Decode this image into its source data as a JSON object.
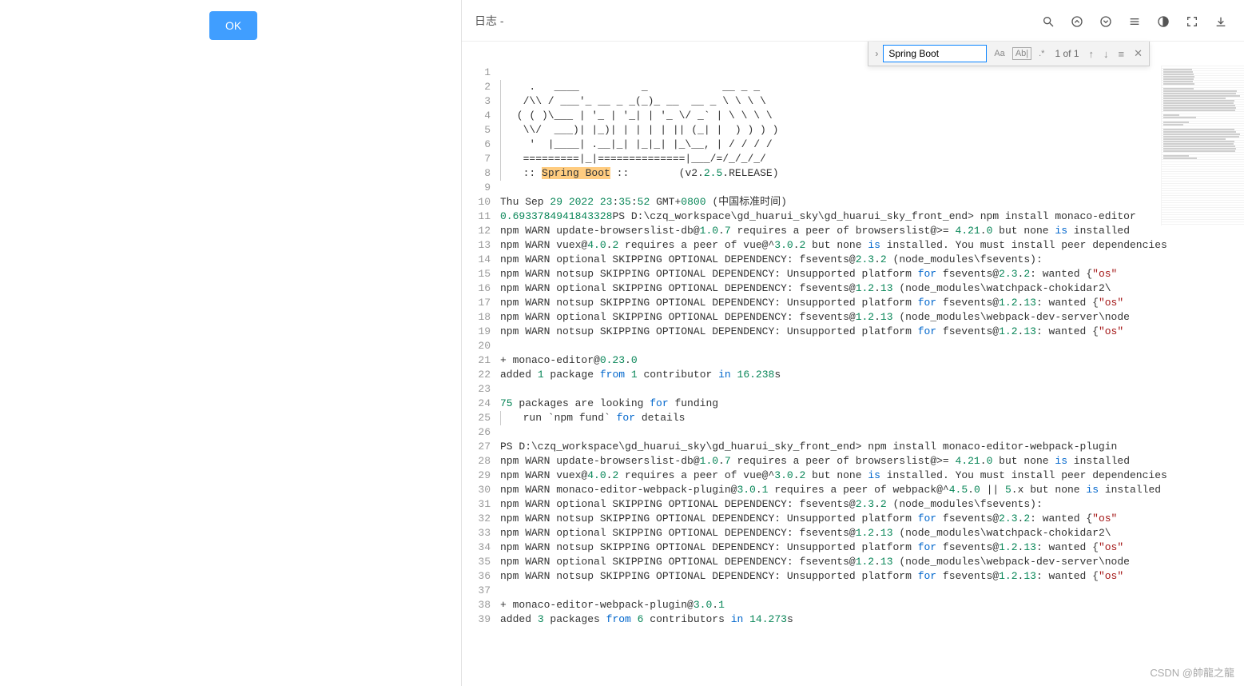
{
  "left": {
    "ok_label": "OK"
  },
  "header": {
    "title": "日志 -"
  },
  "toolbar": {
    "icons": [
      "search",
      "collapse-up",
      "expand-down",
      "menu",
      "contrast",
      "fullscreen",
      "download"
    ]
  },
  "find": {
    "input": "Spring Boot",
    "opt_case": "Aa",
    "opt_word": "Ab|",
    "opt_regex": ".*",
    "count": "1 of 1"
  },
  "editor": {
    "total_lines": 39,
    "lines": [
      {
        "n": 1,
        "segs": []
      },
      {
        "n": 2,
        "indent": true,
        "segs": [
          {
            "t": "   .   ____          _            __ _ _"
          }
        ]
      },
      {
        "n": 3,
        "indent": true,
        "segs": [
          {
            "t": "  /\\\\ / ___'_ __ _ _(_)_ __  __ _ \\ \\ \\ \\"
          }
        ]
      },
      {
        "n": 4,
        "indent": true,
        "segs": [
          {
            "t": " ( ( )\\___ | '_ | '_| | '_ \\/ _` | \\ \\ \\ \\"
          }
        ]
      },
      {
        "n": 5,
        "indent": true,
        "segs": [
          {
            "t": "  \\\\/  ___)| |_)| | | | | || (_| |  ) ) ) )"
          }
        ]
      },
      {
        "n": 6,
        "indent": true,
        "segs": [
          {
            "t": "   '  |____| .__|_| |_|_| |_\\__, | / / / /"
          }
        ]
      },
      {
        "n": 7,
        "indent": true,
        "segs": [
          {
            "t": "  =========|_|==============|___/=/_/_/_/"
          }
        ]
      },
      {
        "n": 8,
        "indent": true,
        "segs": [
          {
            "t": "  :: ",
            "c": ""
          },
          {
            "t": "Spring Boot",
            "c": "hl"
          },
          {
            "t": " ::        (v2.",
            "c": ""
          },
          {
            "t": "2.5",
            "c": "c-num"
          },
          {
            "t": ".RELEASE)",
            "c": ""
          }
        ]
      },
      {
        "n": 9,
        "segs": []
      },
      {
        "n": 10,
        "segs": [
          {
            "t": "Thu Sep ",
            "c": ""
          },
          {
            "t": "29 2022 23",
            "c": "c-num"
          },
          {
            "t": ":",
            "c": ""
          },
          {
            "t": "35",
            "c": "c-num"
          },
          {
            "t": ":",
            "c": ""
          },
          {
            "t": "52",
            "c": "c-num"
          },
          {
            "t": " GMT+",
            "c": ""
          },
          {
            "t": "0800",
            "c": "c-num"
          },
          {
            "t": " (中国标准时间)",
            "c": ""
          }
        ]
      },
      {
        "n": 11,
        "segs": [
          {
            "t": "0.6933784941843328",
            "c": "c-num"
          },
          {
            "t": "PS D:\\czq_workspace\\gd_huarui_sky\\gd_huarui_sky_front_end> npm install monaco-editor",
            "c": ""
          }
        ]
      },
      {
        "n": 12,
        "segs": [
          {
            "t": "npm WARN update-browserslist-db@",
            "c": ""
          },
          {
            "t": "1.0",
            "c": "c-num"
          },
          {
            "t": ".",
            "c": ""
          },
          {
            "t": "7",
            "c": "c-num"
          },
          {
            "t": " requires a peer of browserslist@>= ",
            "c": ""
          },
          {
            "t": "4.21",
            "c": "c-num"
          },
          {
            "t": ".",
            "c": ""
          },
          {
            "t": "0",
            "c": "c-num"
          },
          {
            "t": " but none ",
            "c": ""
          },
          {
            "t": "is",
            "c": "c-blue"
          },
          {
            "t": " installed",
            "c": ""
          }
        ]
      },
      {
        "n": 13,
        "segs": [
          {
            "t": "npm WARN vuex@",
            "c": ""
          },
          {
            "t": "4.0",
            "c": "c-num"
          },
          {
            "t": ".",
            "c": ""
          },
          {
            "t": "2",
            "c": "c-num"
          },
          {
            "t": " requires a peer of vue@^",
            "c": ""
          },
          {
            "t": "3.0",
            "c": "c-num"
          },
          {
            "t": ".",
            "c": ""
          },
          {
            "t": "2",
            "c": "c-num"
          },
          {
            "t": " but none ",
            "c": ""
          },
          {
            "t": "is",
            "c": "c-blue"
          },
          {
            "t": " installed. You must install peer dependencies",
            "c": ""
          }
        ]
      },
      {
        "n": 14,
        "segs": [
          {
            "t": "npm WARN optional SKIPPING OPTIONAL DEPENDENCY: fsevents@",
            "c": ""
          },
          {
            "t": "2.3",
            "c": "c-num"
          },
          {
            "t": ".",
            "c": ""
          },
          {
            "t": "2",
            "c": "c-num"
          },
          {
            "t": " (node_modules\\fsevents):",
            "c": ""
          }
        ]
      },
      {
        "n": 15,
        "segs": [
          {
            "t": "npm WARN notsup SKIPPING OPTIONAL DEPENDENCY: Unsupported platform ",
            "c": ""
          },
          {
            "t": "for",
            "c": "c-blue"
          },
          {
            "t": " fsevents@",
            "c": ""
          },
          {
            "t": "2.3",
            "c": "c-num"
          },
          {
            "t": ".",
            "c": ""
          },
          {
            "t": "2",
            "c": "c-num"
          },
          {
            "t": ": wanted {",
            "c": ""
          },
          {
            "t": "\"os\"",
            "c": "c-str"
          }
        ]
      },
      {
        "n": 16,
        "segs": [
          {
            "t": "npm WARN optional SKIPPING OPTIONAL DEPENDENCY: fsevents@",
            "c": ""
          },
          {
            "t": "1.2",
            "c": "c-num"
          },
          {
            "t": ".",
            "c": ""
          },
          {
            "t": "13",
            "c": "c-num"
          },
          {
            "t": " (node_modules\\watchpack-chokidar2\\",
            "c": ""
          }
        ]
      },
      {
        "n": 17,
        "segs": [
          {
            "t": "npm WARN notsup SKIPPING OPTIONAL DEPENDENCY: Unsupported platform ",
            "c": ""
          },
          {
            "t": "for",
            "c": "c-blue"
          },
          {
            "t": " fsevents@",
            "c": ""
          },
          {
            "t": "1.2",
            "c": "c-num"
          },
          {
            "t": ".",
            "c": ""
          },
          {
            "t": "13",
            "c": "c-num"
          },
          {
            "t": ": wanted {",
            "c": ""
          },
          {
            "t": "\"os\"",
            "c": "c-str"
          }
        ]
      },
      {
        "n": 18,
        "segs": [
          {
            "t": "npm WARN optional SKIPPING OPTIONAL DEPENDENCY: fsevents@",
            "c": ""
          },
          {
            "t": "1.2",
            "c": "c-num"
          },
          {
            "t": ".",
            "c": ""
          },
          {
            "t": "13",
            "c": "c-num"
          },
          {
            "t": " (node_modules\\webpack-dev-server\\node",
            "c": ""
          }
        ]
      },
      {
        "n": 19,
        "segs": [
          {
            "t": "npm WARN notsup SKIPPING OPTIONAL DEPENDENCY: Unsupported platform ",
            "c": ""
          },
          {
            "t": "for",
            "c": "c-blue"
          },
          {
            "t": " fsevents@",
            "c": ""
          },
          {
            "t": "1.2",
            "c": "c-num"
          },
          {
            "t": ".",
            "c": ""
          },
          {
            "t": "13",
            "c": "c-num"
          },
          {
            "t": ": wanted {",
            "c": ""
          },
          {
            "t": "\"os\"",
            "c": "c-str"
          }
        ]
      },
      {
        "n": 20,
        "segs": []
      },
      {
        "n": 21,
        "segs": [
          {
            "t": "+ monaco-editor@",
            "c": ""
          },
          {
            "t": "0.23",
            "c": "c-num"
          },
          {
            "t": ".",
            "c": ""
          },
          {
            "t": "0",
            "c": "c-num"
          }
        ]
      },
      {
        "n": 22,
        "segs": [
          {
            "t": "added ",
            "c": ""
          },
          {
            "t": "1",
            "c": "c-num"
          },
          {
            "t": " package ",
            "c": ""
          },
          {
            "t": "from",
            "c": "c-blue"
          },
          {
            "t": " ",
            "c": ""
          },
          {
            "t": "1",
            "c": "c-num"
          },
          {
            "t": " contributor ",
            "c": ""
          },
          {
            "t": "in",
            "c": "c-blue"
          },
          {
            "t": " ",
            "c": ""
          },
          {
            "t": "16.238",
            "c": "c-num"
          },
          {
            "t": "s",
            "c": ""
          }
        ]
      },
      {
        "n": 23,
        "segs": []
      },
      {
        "n": 24,
        "segs": [
          {
            "t": "75",
            "c": "c-num"
          },
          {
            "t": " packages are looking ",
            "c": ""
          },
          {
            "t": "for",
            "c": "c-blue"
          },
          {
            "t": " funding",
            "c": ""
          }
        ]
      },
      {
        "n": 25,
        "indent": true,
        "segs": [
          {
            "t": "  run `npm fund` ",
            "c": ""
          },
          {
            "t": "for",
            "c": "c-blue"
          },
          {
            "t": " details",
            "c": ""
          }
        ]
      },
      {
        "n": 26,
        "segs": []
      },
      {
        "n": 27,
        "segs": [
          {
            "t": "PS D:\\czq_workspace\\gd_huarui_sky\\gd_huarui_sky_front_end> npm install monaco-editor-webpack-plugin",
            "c": ""
          }
        ]
      },
      {
        "n": 28,
        "segs": [
          {
            "t": "npm WARN update-browserslist-db@",
            "c": ""
          },
          {
            "t": "1.0",
            "c": "c-num"
          },
          {
            "t": ".",
            "c": ""
          },
          {
            "t": "7",
            "c": "c-num"
          },
          {
            "t": " requires a peer of browserslist@>= ",
            "c": ""
          },
          {
            "t": "4.21",
            "c": "c-num"
          },
          {
            "t": ".",
            "c": ""
          },
          {
            "t": "0",
            "c": "c-num"
          },
          {
            "t": " but none ",
            "c": ""
          },
          {
            "t": "is",
            "c": "c-blue"
          },
          {
            "t": " installed",
            "c": ""
          }
        ]
      },
      {
        "n": 29,
        "segs": [
          {
            "t": "npm WARN vuex@",
            "c": ""
          },
          {
            "t": "4.0",
            "c": "c-num"
          },
          {
            "t": ".",
            "c": ""
          },
          {
            "t": "2",
            "c": "c-num"
          },
          {
            "t": " requires a peer of vue@^",
            "c": ""
          },
          {
            "t": "3.0",
            "c": "c-num"
          },
          {
            "t": ".",
            "c": ""
          },
          {
            "t": "2",
            "c": "c-num"
          },
          {
            "t": " but none ",
            "c": ""
          },
          {
            "t": "is",
            "c": "c-blue"
          },
          {
            "t": " installed. You must install peer dependencies",
            "c": ""
          }
        ]
      },
      {
        "n": 30,
        "segs": [
          {
            "t": "npm WARN monaco-editor-webpack-plugin@",
            "c": ""
          },
          {
            "t": "3.0",
            "c": "c-num"
          },
          {
            "t": ".",
            "c": ""
          },
          {
            "t": "1",
            "c": "c-num"
          },
          {
            "t": " requires a peer of webpack@^",
            "c": ""
          },
          {
            "t": "4.5",
            "c": "c-num"
          },
          {
            "t": ".",
            "c": ""
          },
          {
            "t": "0",
            "c": "c-num"
          },
          {
            "t": " || ",
            "c": ""
          },
          {
            "t": "5",
            "c": "c-num"
          },
          {
            "t": ".x but none ",
            "c": ""
          },
          {
            "t": "is",
            "c": "c-blue"
          },
          {
            "t": " installed",
            "c": ""
          }
        ]
      },
      {
        "n": 31,
        "segs": [
          {
            "t": "npm WARN optional SKIPPING OPTIONAL DEPENDENCY: fsevents@",
            "c": ""
          },
          {
            "t": "2.3",
            "c": "c-num"
          },
          {
            "t": ".",
            "c": ""
          },
          {
            "t": "2",
            "c": "c-num"
          },
          {
            "t": " (node_modules\\fsevents):",
            "c": ""
          }
        ]
      },
      {
        "n": 32,
        "segs": [
          {
            "t": "npm WARN notsup SKIPPING OPTIONAL DEPENDENCY: Unsupported platform ",
            "c": ""
          },
          {
            "t": "for",
            "c": "c-blue"
          },
          {
            "t": " fsevents@",
            "c": ""
          },
          {
            "t": "2.3",
            "c": "c-num"
          },
          {
            "t": ".",
            "c": ""
          },
          {
            "t": "2",
            "c": "c-num"
          },
          {
            "t": ": wanted {",
            "c": ""
          },
          {
            "t": "\"os\"",
            "c": "c-str"
          }
        ]
      },
      {
        "n": 33,
        "segs": [
          {
            "t": "npm WARN optional SKIPPING OPTIONAL DEPENDENCY: fsevents@",
            "c": ""
          },
          {
            "t": "1.2",
            "c": "c-num"
          },
          {
            "t": ".",
            "c": ""
          },
          {
            "t": "13",
            "c": "c-num"
          },
          {
            "t": " (node_modules\\watchpack-chokidar2\\",
            "c": ""
          }
        ]
      },
      {
        "n": 34,
        "segs": [
          {
            "t": "npm WARN notsup SKIPPING OPTIONAL DEPENDENCY: Unsupported platform ",
            "c": ""
          },
          {
            "t": "for",
            "c": "c-blue"
          },
          {
            "t": " fsevents@",
            "c": ""
          },
          {
            "t": "1.2",
            "c": "c-num"
          },
          {
            "t": ".",
            "c": ""
          },
          {
            "t": "13",
            "c": "c-num"
          },
          {
            "t": ": wanted {",
            "c": ""
          },
          {
            "t": "\"os\"",
            "c": "c-str"
          }
        ]
      },
      {
        "n": 35,
        "segs": [
          {
            "t": "npm WARN optional SKIPPING OPTIONAL DEPENDENCY: fsevents@",
            "c": ""
          },
          {
            "t": "1.2",
            "c": "c-num"
          },
          {
            "t": ".",
            "c": ""
          },
          {
            "t": "13",
            "c": "c-num"
          },
          {
            "t": " (node_modules\\webpack-dev-server\\node",
            "c": ""
          }
        ]
      },
      {
        "n": 36,
        "segs": [
          {
            "t": "npm WARN notsup SKIPPING OPTIONAL DEPENDENCY: Unsupported platform ",
            "c": ""
          },
          {
            "t": "for",
            "c": "c-blue"
          },
          {
            "t": " fsevents@",
            "c": ""
          },
          {
            "t": "1.2",
            "c": "c-num"
          },
          {
            "t": ".",
            "c": ""
          },
          {
            "t": "13",
            "c": "c-num"
          },
          {
            "t": ": wanted {",
            "c": ""
          },
          {
            "t": "\"os\"",
            "c": "c-str"
          }
        ]
      },
      {
        "n": 37,
        "segs": []
      },
      {
        "n": 38,
        "segs": [
          {
            "t": "+ monaco-editor-webpack-plugin@",
            "c": ""
          },
          {
            "t": "3.0",
            "c": "c-num"
          },
          {
            "t": ".",
            "c": ""
          },
          {
            "t": "1",
            "c": "c-num"
          }
        ]
      },
      {
        "n": 39,
        "segs": [
          {
            "t": "added ",
            "c": ""
          },
          {
            "t": "3",
            "c": "c-num"
          },
          {
            "t": " packages ",
            "c": ""
          },
          {
            "t": "from",
            "c": "c-blue"
          },
          {
            "t": " ",
            "c": ""
          },
          {
            "t": "6",
            "c": "c-num"
          },
          {
            "t": " contributors ",
            "c": ""
          },
          {
            "t": "in",
            "c": "c-blue"
          },
          {
            "t": " ",
            "c": ""
          },
          {
            "t": "14.273",
            "c": "c-num"
          },
          {
            "t": "s",
            "c": ""
          }
        ]
      }
    ]
  },
  "watermark": "CSDN @帥龍之龍"
}
